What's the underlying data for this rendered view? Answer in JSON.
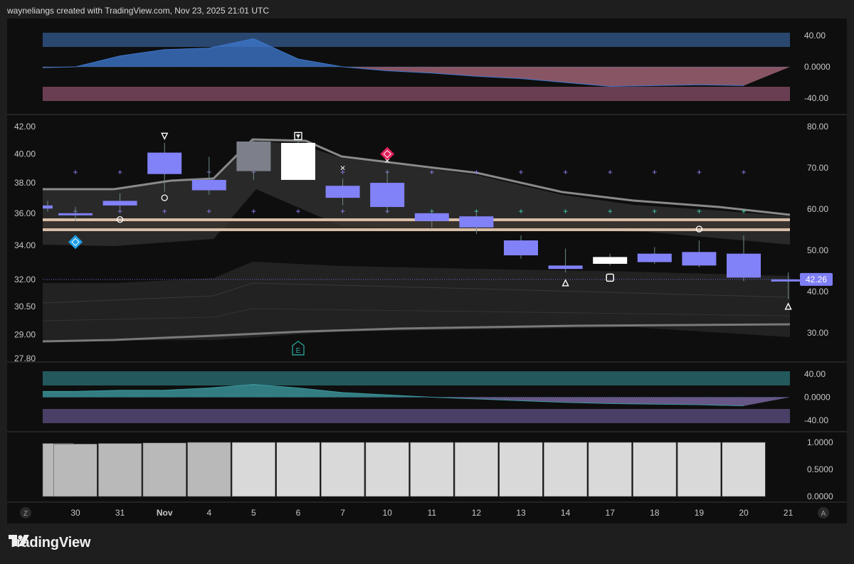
{
  "header": {
    "attribution": "wayneliangs created with TradingView.com, Nov 23, 2025 21:01 UTC"
  },
  "brand": {
    "name": "TradingView"
  },
  "axis_buttons": {
    "left": "Z",
    "right": "A"
  },
  "colors": {
    "background": "#0e0e0e",
    "candle": "#8181f8",
    "price_tag": "#7e7ef5",
    "osc_positive": "#3d76c9",
    "osc_negative": "#a8687c",
    "osc_lower_positive": "#3c9aa0",
    "osc_lower_negative": "#7d6aa6",
    "volume_bar": "#d9d9d9"
  },
  "chart_data": {
    "type": "candlestick",
    "x_labels": [
      "30",
      "31",
      "Nov",
      "4",
      "5",
      "6",
      "7",
      "10",
      "11",
      "12",
      "13",
      "14",
      "17",
      "18",
      "19",
      "20",
      "21"
    ],
    "price_axis": {
      "ticks": [
        "42.00",
        "40.00",
        "38.00",
        "36.00",
        "34.00",
        "32.00",
        "30.50",
        "29.00",
        "27.80"
      ],
      "scale": "log",
      "range": [
        27.8,
        42.0
      ]
    },
    "secondary_axis": {
      "ticks": [
        "80.00",
        "70.00",
        "60.00",
        "50.00",
        "40.00",
        "30.00"
      ],
      "range": [
        30,
        80
      ]
    },
    "last_value_label": "42.26",
    "last_value_level": 32.0,
    "candles": [
      {
        "x": "29",
        "open": 36.5,
        "close": 36.3,
        "high": 36.8,
        "low": 36.1,
        "partial": true
      },
      {
        "x": "30",
        "open": 36.0,
        "close": 35.9,
        "high": 36.4,
        "low": 35.5
      },
      {
        "x": "31",
        "open": 36.5,
        "close": 36.8,
        "high": 37.3,
        "low": 36.2
      },
      {
        "x": "Nov 3",
        "open": 38.6,
        "close": 40.1,
        "high": 40.8,
        "low": 37.4
      },
      {
        "x": "4",
        "open": 37.5,
        "close": 38.2,
        "high": 39.8,
        "low": 37.2
      },
      {
        "x": "5",
        "open": 40.9,
        "close": 38.8,
        "high": 41.0,
        "low": 38.2
      },
      {
        "x": "6",
        "open": 38.2,
        "close": 40.8,
        "high": 41.6,
        "low": 38.2
      },
      {
        "x": "7",
        "open": 37.0,
        "close": 37.8,
        "high": 38.3,
        "low": 36.5
      },
      {
        "x": "10",
        "open": 36.4,
        "close": 38.0,
        "high": 38.9,
        "low": 36.0
      },
      {
        "x": "11",
        "open": 36.0,
        "close": 35.5,
        "high": 36.2,
        "low": 35.1
      },
      {
        "x": "12",
        "open": 35.8,
        "close": 35.1,
        "high": 36.1,
        "low": 34.7
      },
      {
        "x": "13",
        "open": 34.3,
        "close": 33.4,
        "high": 34.6,
        "low": 33.2
      },
      {
        "x": "14",
        "open": 32.8,
        "close": 32.6,
        "high": 33.8,
        "low": 32.4
      },
      {
        "x": "17",
        "open": 32.9,
        "close": 33.3,
        "high": 33.5,
        "low": 32.8
      },
      {
        "x": "18",
        "open": 33.0,
        "close": 33.5,
        "high": 33.9,
        "low": 32.9
      },
      {
        "x": "19",
        "open": 33.6,
        "close": 32.8,
        "high": 34.3,
        "low": 32.7
      },
      {
        "x": "20",
        "open": 33.5,
        "close": 32.1,
        "high": 34.6,
        "low": 31.9
      },
      {
        "x": "21",
        "open": 32.0,
        "close": 31.9,
        "high": 32.4,
        "low": 30.9
      }
    ],
    "signal_marks": [
      {
        "x": "Nov 3",
        "shape": "triangle-down",
        "level": 41.3
      },
      {
        "x": "6",
        "shape": "square-triangle",
        "level": 41.3
      },
      {
        "x": "30",
        "shape": "diamond-blue",
        "level": 34.2
      },
      {
        "x": "10",
        "shape": "diamond-red",
        "level": 40.0
      },
      {
        "x": "7",
        "shape": "cross",
        "level": 39.0
      },
      {
        "x": "10",
        "shape": "cross",
        "level": 39.5
      },
      {
        "x": "Nov 3",
        "shape": "circle",
        "level": 37.0
      },
      {
        "x": "31",
        "shape": "circle",
        "level": 35.6
      },
      {
        "x": "19",
        "shape": "circle",
        "level": 35.0
      },
      {
        "x": "14",
        "shape": "triangle-up",
        "level": 31.8
      },
      {
        "x": "17",
        "shape": "square",
        "level": 32.1
      },
      {
        "x": "21",
        "shape": "triangle-up",
        "level": 30.5
      },
      {
        "x": "6",
        "shape": "earnings",
        "level": 28.3
      }
    ],
    "earnings_label": "E",
    "upper_oscillator": {
      "ticks": [
        "40.00",
        "0.0000",
        "-40.00"
      ],
      "range": [
        -40,
        40
      ],
      "values": [
        -1,
        0,
        14,
        22,
        24,
        36,
        10,
        0,
        -5,
        -8,
        -12,
        -15,
        -20,
        -25,
        -24,
        -23,
        -24
      ]
    },
    "lower_oscillator": {
      "ticks": [
        "40.00",
        "0.0000",
        "-40.00"
      ],
      "range": [
        -40,
        40
      ],
      "values": [
        10,
        10,
        12,
        12,
        16,
        22,
        16,
        8,
        4,
        0,
        -3,
        -6,
        -9,
        -11,
        -12,
        -13,
        -15
      ]
    },
    "volume_pane": {
      "ticks": [
        "1.0000",
        "0.5000",
        "0.0000"
      ],
      "range": [
        0,
        1
      ],
      "values": [
        0.98,
        0.97,
        0.98,
        0.99,
        1.0,
        1.0,
        1.0,
        1.0,
        1.0,
        1.0,
        1.0,
        1.0,
        1.0,
        1.0,
        1.0,
        1.0,
        1.0
      ]
    }
  }
}
